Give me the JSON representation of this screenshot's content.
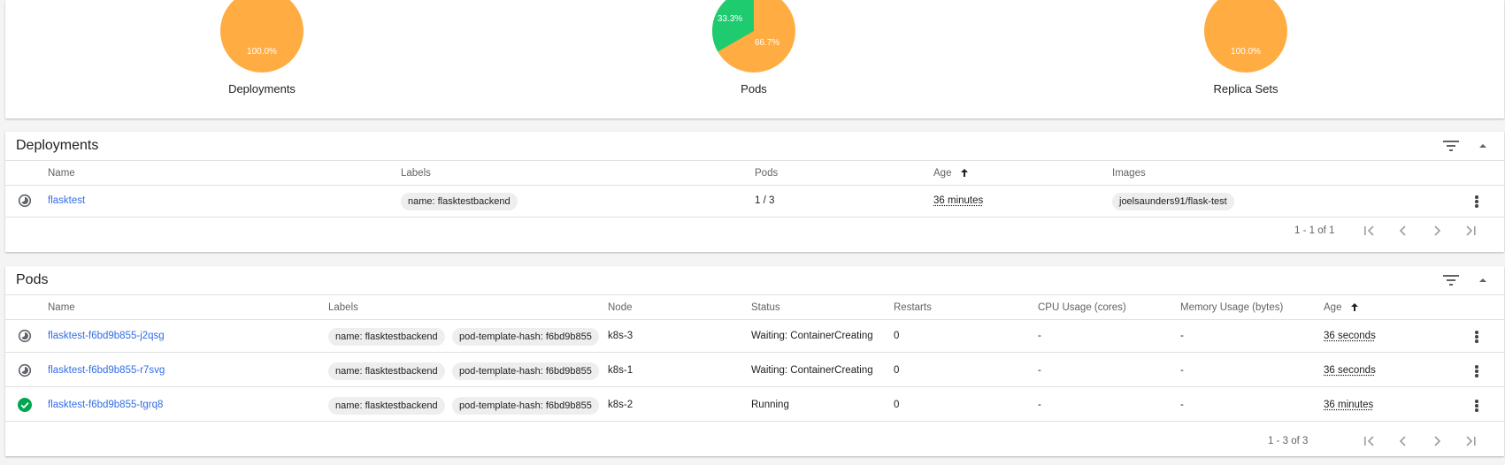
{
  "summary": {
    "pies": [
      {
        "title": "Deployments",
        "label_main": "100.0%"
      },
      {
        "title": "Pods",
        "label_main": "66.7%",
        "label_other": "33.3%",
        "running_fraction": 0.333
      },
      {
        "title": "Replica Sets",
        "label_main": "100.0%"
      }
    ]
  },
  "colors": {
    "pending": "#ffad42",
    "running": "#1fcb6f",
    "link": "#326de6"
  },
  "deployments": {
    "title": "Deployments",
    "columns": {
      "name": "Name",
      "labels": "Labels",
      "pods": "Pods",
      "age": "Age",
      "images": "Images"
    },
    "rows": [
      {
        "status": "pending",
        "name": "flasktest",
        "label": "name: flasktestbackend",
        "pods": "1 / 3",
        "age": "36 minutes",
        "image": "joelsaunders91/flask-test"
      }
    ],
    "pager": "1 - 1 of 1"
  },
  "pods": {
    "title": "Pods",
    "columns": {
      "name": "Name",
      "labels": "Labels",
      "node": "Node",
      "status": "Status",
      "restarts": "Restarts",
      "cpu": "CPU Usage (cores)",
      "memory": "Memory Usage (bytes)",
      "age": "Age"
    },
    "rows": [
      {
        "status": "pending",
        "name": "flasktest-f6bd9b855-j2qsg",
        "label1": "name: flasktestbackend",
        "label2": "pod-template-hash: f6bd9b855",
        "node": "k8s-3",
        "state": "Waiting: ContainerCreating",
        "restarts": "0",
        "cpu": "-",
        "memory": "-",
        "age": "36 seconds"
      },
      {
        "status": "pending",
        "name": "flasktest-f6bd9b855-r7svg",
        "label1": "name: flasktestbackend",
        "label2": "pod-template-hash: f6bd9b855",
        "node": "k8s-1",
        "state": "Waiting: ContainerCreating",
        "restarts": "0",
        "cpu": "-",
        "memory": "-",
        "age": "36 seconds"
      },
      {
        "status": "running",
        "name": "flasktest-f6bd9b855-tgrq8",
        "label1": "name: flasktestbackend",
        "label2": "pod-template-hash: f6bd9b855",
        "node": "k8s-2",
        "state": "Running",
        "restarts": "0",
        "cpu": "-",
        "memory": "-",
        "age": "36 minutes"
      }
    ],
    "pager": "1 - 3 of 3"
  }
}
